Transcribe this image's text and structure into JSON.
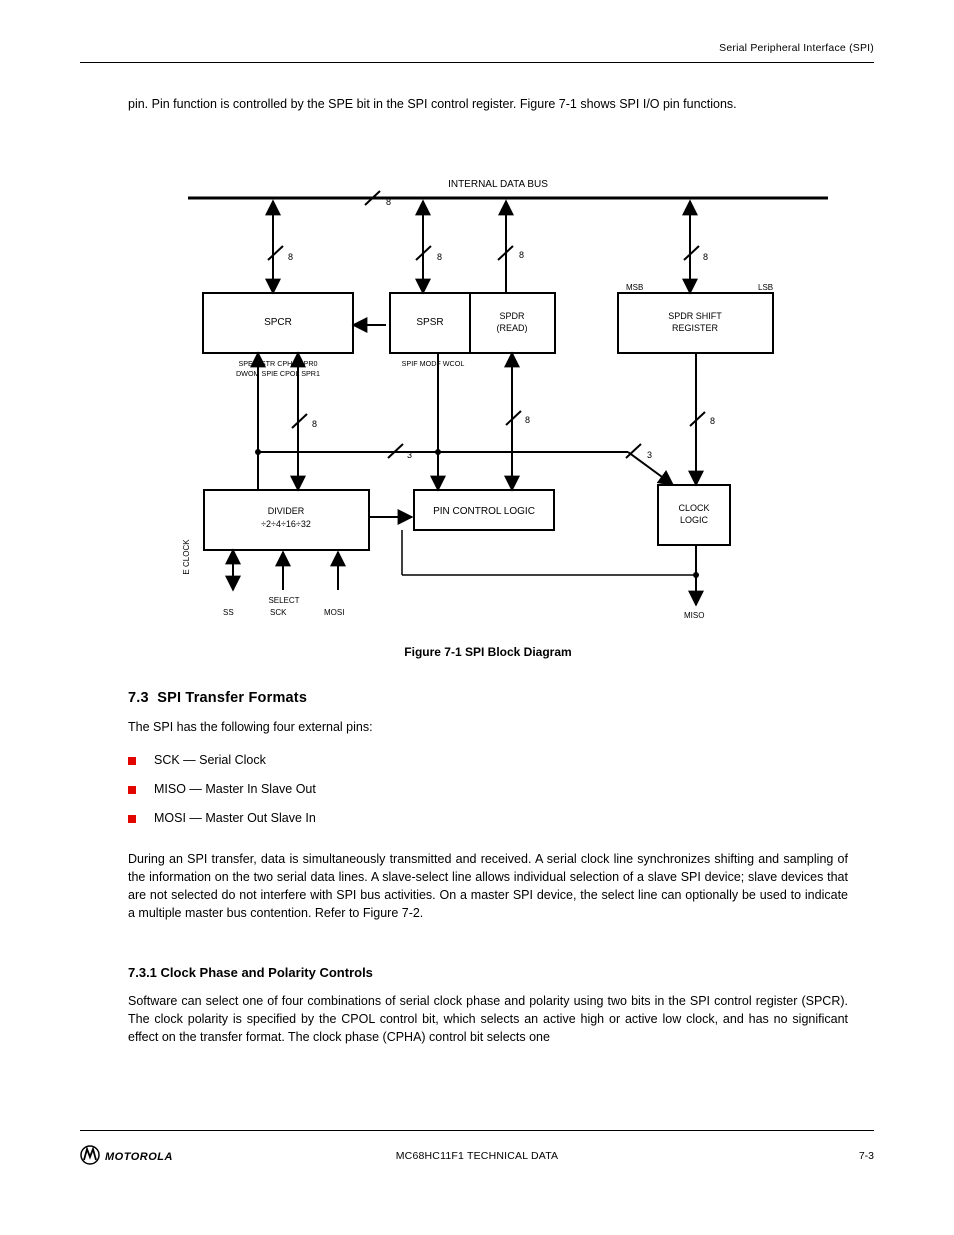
{
  "header": {
    "right": "Serial Peripheral Interface (SPI)"
  },
  "intro": "pin. Pin function is controlled by the SPE bit in the SPI control register. Figure 7-1 shows SPI I/O pin functions.",
  "figure": {
    "bus": "INTERNAL DATA BUS",
    "width8": "8",
    "width3": "3",
    "control": "SPCR",
    "spsr": "SPSR",
    "spdrRead": "SPDR (READ)",
    "spdrShift": "SPDR SHIFT REGISTER",
    "divider": "DIVIDER\n÷2÷4÷16÷32",
    "select": "SELECT",
    "clockLogic": "CLOCK\nLOGIC",
    "pinControl": "PIN CONTROL LOGIC",
    "eclk": "E CLOCK",
    "msb": "MSB",
    "lsb": "LSB",
    "signals": [
      "SS",
      "SCK",
      "MOSI",
      "MISO"
    ],
    "spsr_bits": "SPIF     MODF    WCOL",
    "spcr_bits": "SPE    MSTR    CPHA    SPR0\nDWOM    SPIE     CPOL    SPR1",
    "caption": "Figure 7-1  SPI Block Diagram"
  },
  "section": {
    "num": "7.3",
    "title": "SPI Transfer Formats",
    "p1": "During an SPI transfer, data is simultaneously transmitted and received. A serial clock line synchronizes shifting and sampling of the information on the two serial data lines. A slave-select line allows individual selection of a slave SPI device; slave devices that are not selected do not interfere with SPI bus activities. On a master SPI device, the select line can optionally be used to indicate a multiple master bus contention. Refer to Figure 7-2."
  },
  "subsection": {
    "num": "7.3.1",
    "title": "Clock Phase and Polarity Controls",
    "bullets": [
      "SCK — Serial Clock",
      "MISO — Master In Slave Out",
      "MOSI — Master Out Slave In"
    ],
    "p1": "Software can select one of four combinations of serial clock phase and polarity using two bits in the SPI control register (SPCR). The clock polarity is specified by the CPOL control bit, which selects an active high or active low clock, and has no significant effect on the transfer format. The clock phase (CPHA) control bit selects one",
    "label": "7.3.1  Clock Phase and Polarity Controls"
  },
  "footer": {
    "center": "MC68HC11F1 TECHNICAL DATA",
    "right": "7-3"
  }
}
